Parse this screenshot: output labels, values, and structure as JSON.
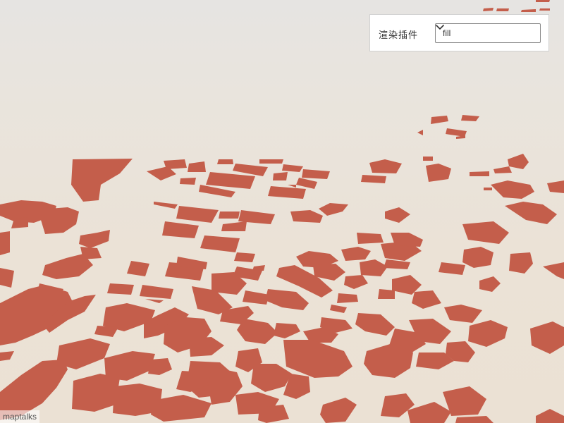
{
  "colors": {
    "building_fill": "#c45e4b",
    "ground_top": "#e6e4e2",
    "ground_bottom": "#ebe1d4",
    "panel_bg": "#ffffff"
  },
  "control_panel": {
    "label": "渲染插件",
    "select": {
      "selected": "fill",
      "options": [
        "fill"
      ]
    },
    "dropdown_icon": "chevron-down-icon"
  },
  "attribution": {
    "text": "maptalks"
  }
}
